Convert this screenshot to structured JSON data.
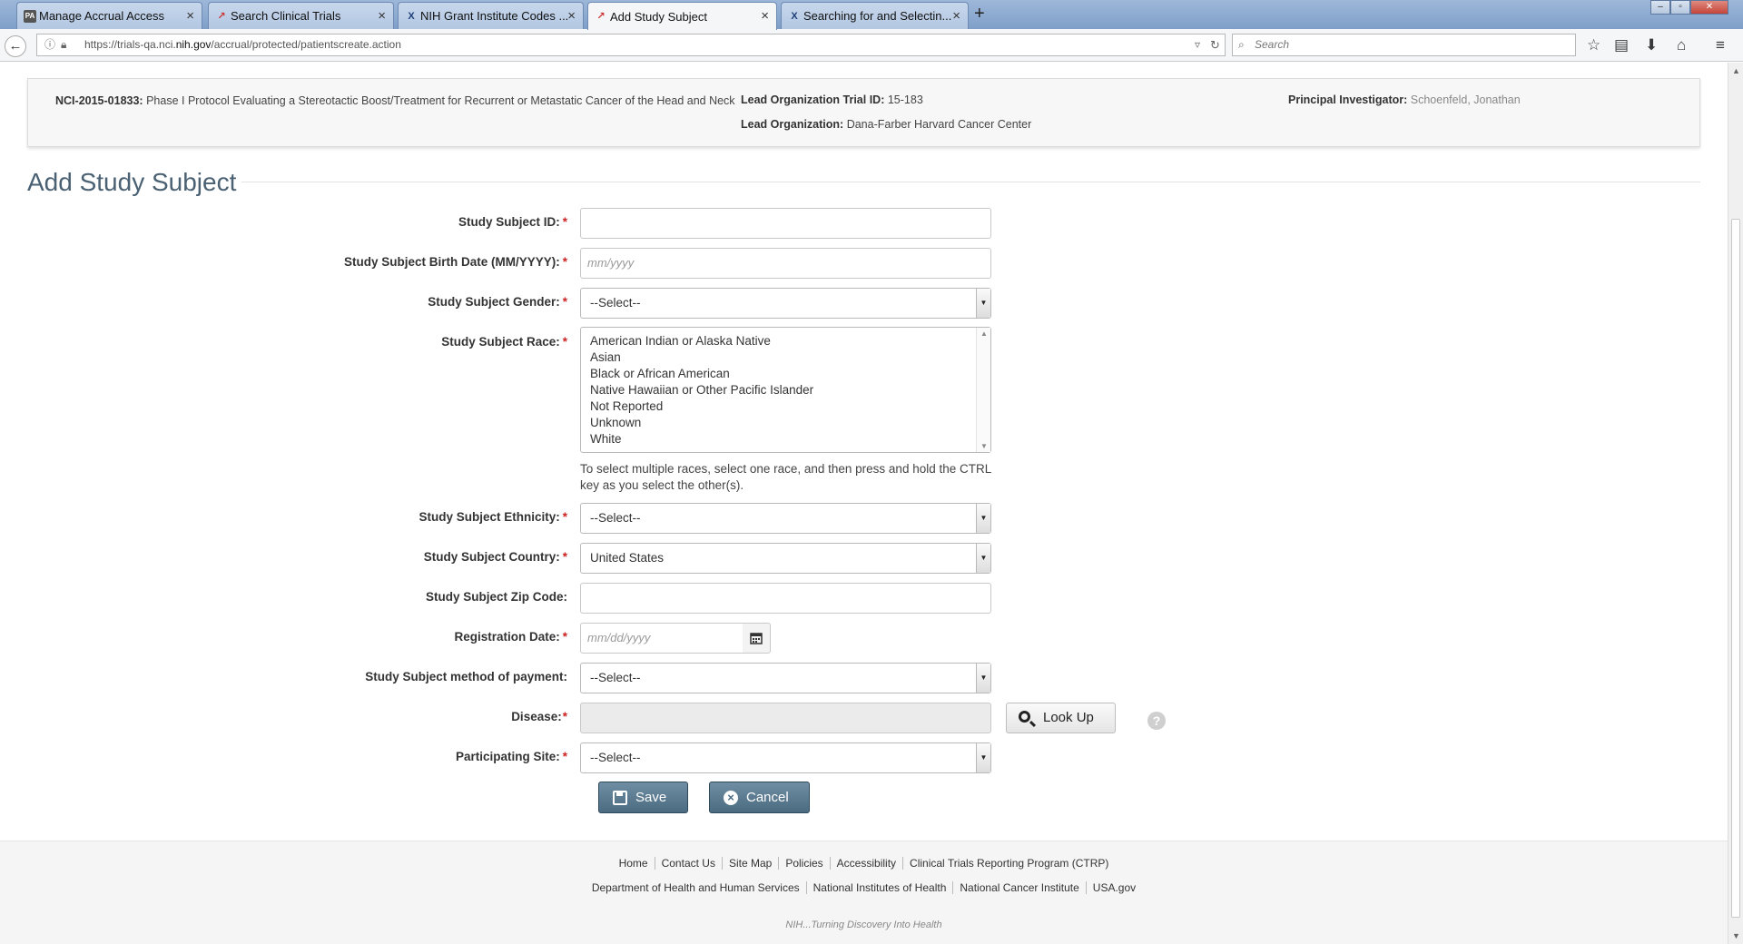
{
  "browser": {
    "tabs": [
      {
        "label": "Manage Accrual Access",
        "icon": "PA"
      },
      {
        "label": "Search Clinical Trials",
        "icon": "chart-icon"
      },
      {
        "label": "NIH Grant Institute Codes ...",
        "icon": "X"
      },
      {
        "label": "Add Study Subject",
        "icon": "chart-icon"
      },
      {
        "label": "Searching for and Selectin...",
        "icon": "X"
      }
    ],
    "url_prefix": "https://trials-qa.nci.",
    "url_host": "nih.gov",
    "url_path": "/accrual/protected/patientscreate.action",
    "search_placeholder": "Search"
  },
  "trial": {
    "id_label": "NCI-2015-01833:",
    "title": "Phase I Protocol Evaluating a Stereotactic Boost/Treatment for Recurrent or Metastatic Cancer of the Head and Neck",
    "lead_trial_id_label": "Lead Organization Trial ID:",
    "lead_trial_id": "15-183",
    "lead_org_label": "Lead Organization:",
    "lead_org": "Dana-Farber Harvard Cancer Center",
    "pi_label": "Principal Investigator:",
    "pi": "Schoenfeld, Jonathan"
  },
  "page_title": "Add Study Subject",
  "form": {
    "subject_id_label": "Study Subject ID:",
    "birth_date_label": "Study Subject Birth Date (MM/YYYY):",
    "birth_date_placeholder": "mm/yyyy",
    "gender_label": "Study Subject Gender:",
    "gender_value": "--Select--",
    "race_label": "Study Subject Race:",
    "race_options": [
      "American Indian or Alaska Native",
      "Asian",
      "Black or African American",
      "Native Hawaiian or Other Pacific Islander",
      "Not Reported",
      "Unknown",
      "White"
    ],
    "race_hint": "To select multiple races, select one race, and then press and hold the CTRL key as you select the other(s).",
    "ethnicity_label": "Study Subject Ethnicity:",
    "ethnicity_value": "--Select--",
    "country_label": "Study Subject Country:",
    "country_value": "United States",
    "zip_label": "Study Subject Zip Code:",
    "reg_date_label": "Registration Date:",
    "reg_date_placeholder": "mm/dd/yyyy",
    "payment_label": "Study Subject method of payment:",
    "payment_value": "--Select--",
    "disease_label": "Disease:",
    "lookup_label": "Look Up",
    "site_label": "Participating Site:",
    "site_value": "--Select--",
    "required_mark": "*",
    "help_mark": "?"
  },
  "actions": {
    "save": "Save",
    "cancel": "Cancel"
  },
  "footer": {
    "links_row1": [
      "Home",
      "Contact Us",
      "Site Map",
      "Policies",
      "Accessibility",
      "Clinical Trials Reporting Program (CTRP)"
    ],
    "links_row2": [
      "Department of Health and Human Services",
      "National Institutes of Health",
      "National Cancer Institute",
      "USA.gov"
    ],
    "tagline": "NIH...Turning Discovery Into Health"
  }
}
